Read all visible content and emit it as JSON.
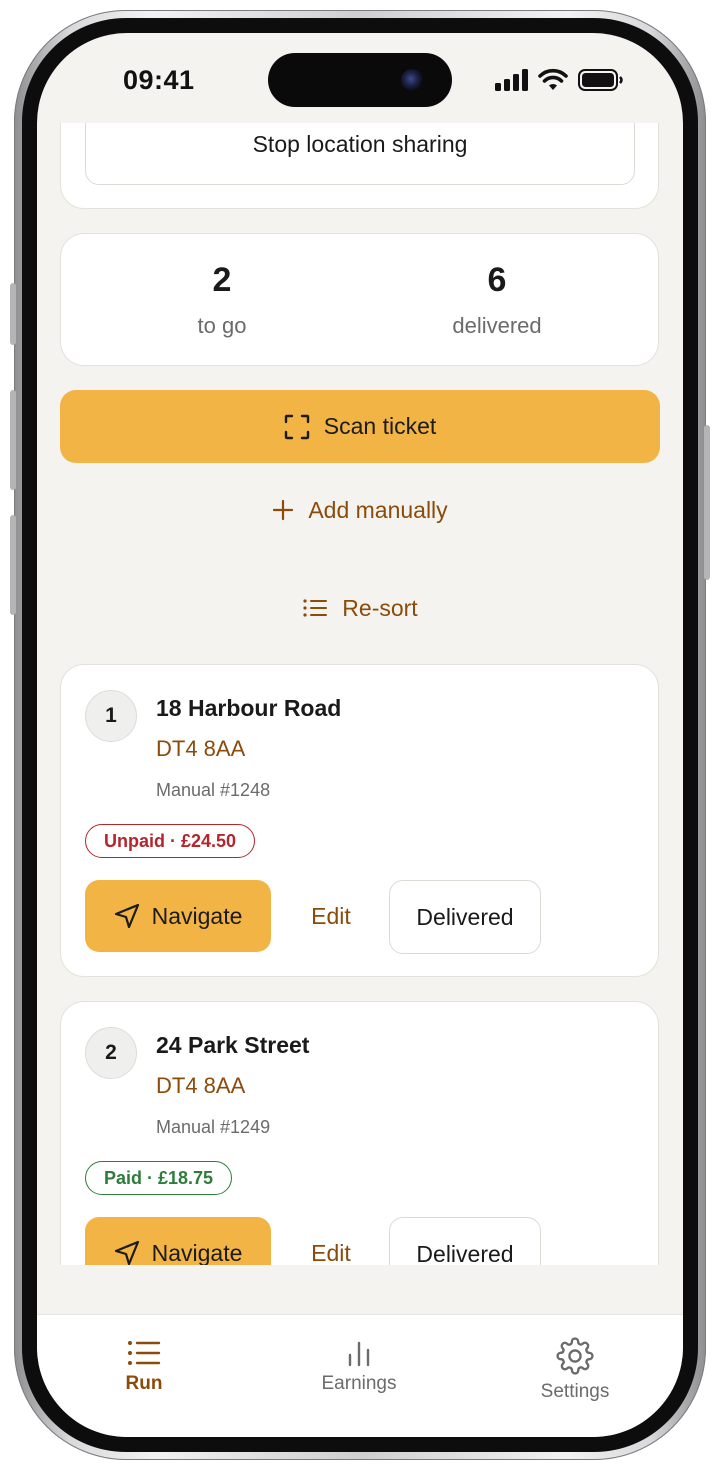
{
  "status_bar": {
    "time": "09:41"
  },
  "location": {
    "stop_button_label": "Stop location sharing"
  },
  "stats": {
    "to_go_value": "2",
    "to_go_label": "to go",
    "delivered_value": "6",
    "delivered_label": "delivered"
  },
  "actions": {
    "scan_label": "Scan ticket",
    "add_manual_label": "Add manually",
    "resort_label": "Re-sort"
  },
  "stops": [
    {
      "number": "1",
      "address": "18 Harbour Road",
      "postcode": "DT4 8AA",
      "ref": "Manual #1248",
      "payment": "Unpaid · £24.50",
      "payment_status": "unpaid",
      "navigate_label": "Navigate",
      "edit_label": "Edit",
      "delivered_label": "Delivered"
    },
    {
      "number": "2",
      "address": "24 Park Street",
      "postcode": "DT4 8AA",
      "ref": "Manual #1249",
      "payment": "Paid · £18.75",
      "payment_status": "paid",
      "navigate_label": "Navigate",
      "edit_label": "Edit",
      "delivered_label": "Delivered"
    }
  ],
  "tabs": [
    {
      "label": "Run",
      "icon": "list-icon",
      "active": true
    },
    {
      "label": "Earnings",
      "icon": "bar-chart-icon",
      "active": false
    },
    {
      "label": "Settings",
      "icon": "gear-icon",
      "active": false
    }
  ],
  "colors": {
    "accent": "#f2b445",
    "brand_text": "#8a4b0b",
    "unpaid": "#b3262e",
    "paid": "#2e7d3a",
    "background": "#f4f3ef"
  }
}
